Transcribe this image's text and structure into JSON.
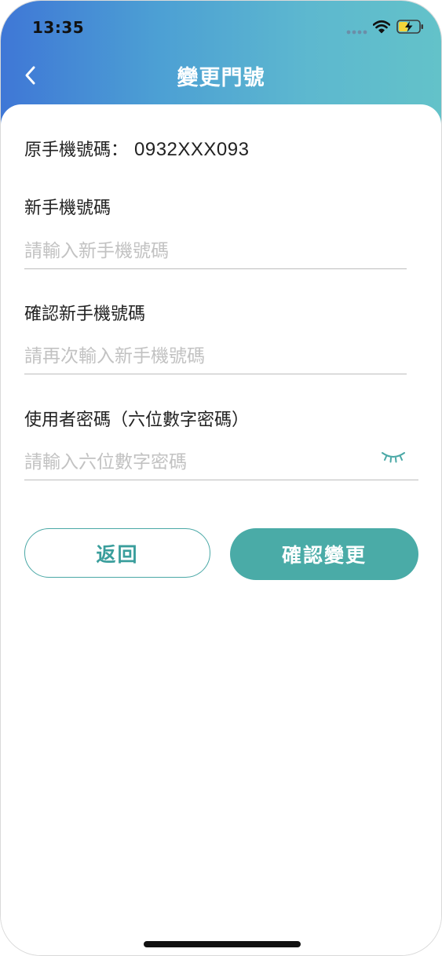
{
  "status_bar": {
    "time": "13:35",
    "icons": [
      "signal-icon",
      "wifi-icon",
      "battery-charging-icon"
    ]
  },
  "nav": {
    "title": "變更門號",
    "back_icon": "chevron-left-icon"
  },
  "original_phone": {
    "label": "原手機號碼：",
    "value": "0932XXX093"
  },
  "new_phone": {
    "label": "新手機號碼",
    "placeholder": "請輸入新手機號碼",
    "value": ""
  },
  "confirm_phone": {
    "label": "確認新手機號碼",
    "placeholder": "請再次輸入新手機號碼",
    "value": ""
  },
  "password": {
    "label": "使用者密碼（六位數字密碼）",
    "placeholder": "請輸入六位數字密碼",
    "value": "",
    "toggle_icon": "eye-closed-icon"
  },
  "buttons": {
    "back_label": "返回",
    "confirm_label": "確認變更"
  },
  "colors": {
    "header_gradient_start": "#3f77d6",
    "header_gradient_end": "#63c2c9",
    "accent": "#4aaba7",
    "placeholder": "#c2c2c2",
    "divider": "#bdbdbd"
  }
}
